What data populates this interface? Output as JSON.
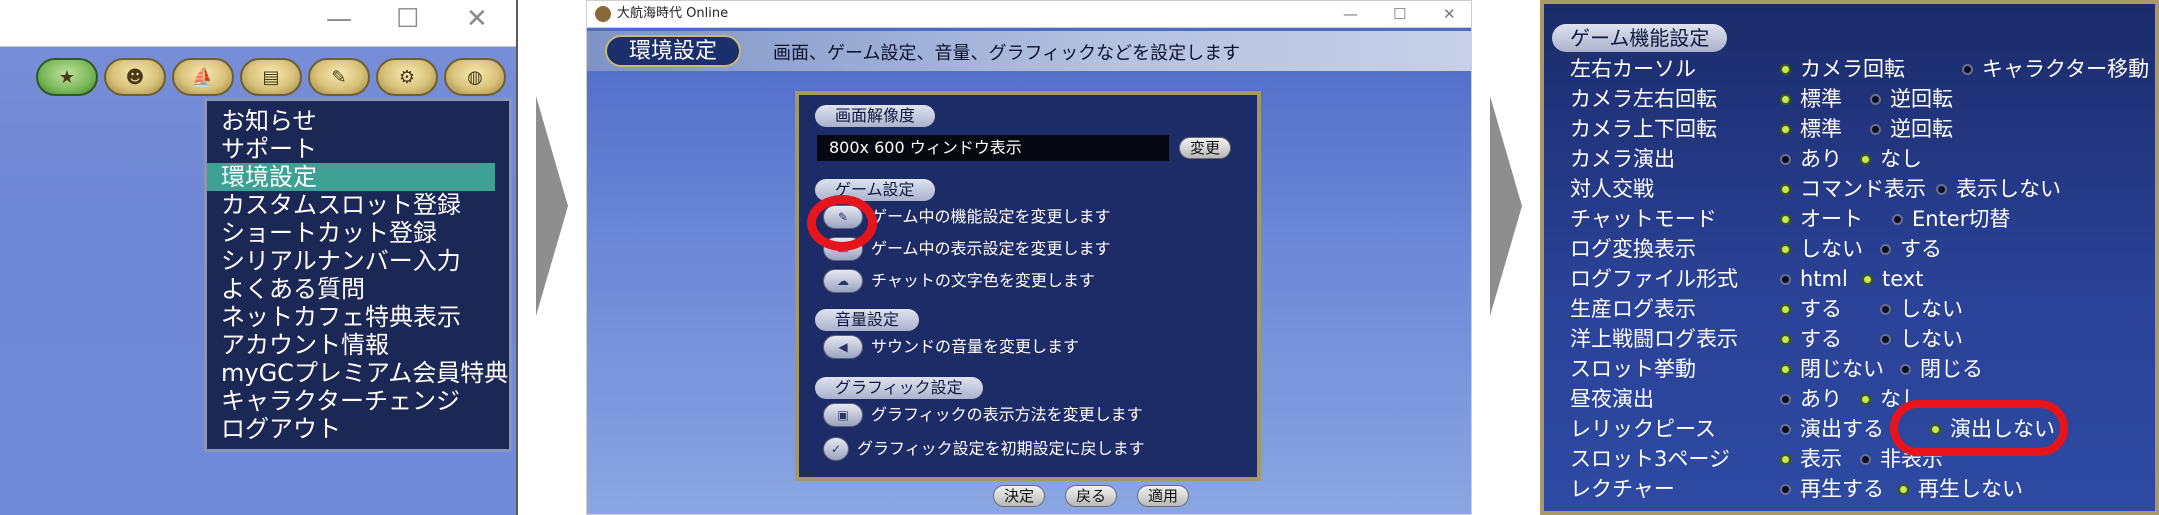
{
  "panel1": {
    "window_controls": [
      "—",
      "☐",
      "✕"
    ],
    "icons": [
      "star-coin-icon",
      "pirate-icon",
      "ship-icon",
      "book-icon",
      "scroll-icon",
      "cart-icon",
      "globe-icon"
    ],
    "menu_items": [
      "お知らせ",
      "サポート",
      "環境設定",
      "カスタムスロット登録",
      "ショートカット登録",
      "シリアルナンバー入力",
      "よくある質問",
      "ネットカフェ特典表示",
      "アカウント情報",
      "myGCプレミアム会員特典",
      "キャラクターチェンジ",
      "ログアウト"
    ],
    "selected_index": 2
  },
  "panel2": {
    "app_title": "大航海時代 Online",
    "window_controls": [
      "—",
      "☐",
      "✕"
    ],
    "header_tag": "環境設定",
    "header_desc": "画面、ゲーム設定、音量、グラフィックなどを設定します",
    "sections": {
      "resolution": {
        "title": "画面解像度",
        "value": "800x 600 ウィンドウ表示",
        "change_button": "変更"
      },
      "game": {
        "title": "ゲーム設定",
        "rows": [
          "ゲーム中の機能設定を変更します",
          "ゲーム中の表示設定を変更します",
          "チャットの文字色を変更します"
        ]
      },
      "volume": {
        "title": "音量設定",
        "rows": [
          "サウンドの音量を変更します"
        ]
      },
      "graphics": {
        "title": "グラフィック設定",
        "rows": [
          "グラフィックの表示方法を変更します",
          "グラフィック設定を初期設定に戻します"
        ]
      }
    },
    "bottom_buttons": [
      "決定",
      "戻る",
      "適用"
    ]
  },
  "panel3": {
    "title": "ゲーム機能設定",
    "rows": [
      {
        "label": "左右カーソル",
        "options": [
          {
            "text": "カメラ回転",
            "on": true
          },
          {
            "text": "キャラクター移動",
            "on": false
          }
        ]
      },
      {
        "label": "カメラ左右回転",
        "options": [
          {
            "text": "標準",
            "on": true
          },
          {
            "text": "逆回転",
            "on": false
          }
        ]
      },
      {
        "label": "カメラ上下回転",
        "options": [
          {
            "text": "標準",
            "on": true
          },
          {
            "text": "逆回転",
            "on": false
          }
        ]
      },
      {
        "label": "カメラ演出",
        "options": [
          {
            "text": "あり",
            "on": false
          },
          {
            "text": "なし",
            "on": true
          }
        ]
      },
      {
        "label": "対人交戦",
        "options": [
          {
            "text": "コマンド表示",
            "on": true
          },
          {
            "text": "表示しない",
            "on": false
          }
        ]
      },
      {
        "label": "チャットモード",
        "options": [
          {
            "text": "オート",
            "on": true
          },
          {
            "text": "Enter切替",
            "on": false
          }
        ]
      },
      {
        "label": "ログ変換表示",
        "options": [
          {
            "text": "しない",
            "on": true
          },
          {
            "text": "する",
            "on": false
          }
        ]
      },
      {
        "label": "ログファイル形式",
        "options": [
          {
            "text": "html",
            "on": false
          },
          {
            "text": "text",
            "on": true
          }
        ]
      },
      {
        "label": "生産ログ表示",
        "options": [
          {
            "text": "する",
            "on": true
          },
          {
            "text": "しない",
            "on": false
          }
        ]
      },
      {
        "label": "洋上戦闘ログ表示",
        "options": [
          {
            "text": "する",
            "on": true
          },
          {
            "text": "しない",
            "on": false
          }
        ]
      },
      {
        "label": "スロット挙動",
        "options": [
          {
            "text": "閉じない",
            "on": true
          },
          {
            "text": "閉じる",
            "on": false
          }
        ]
      },
      {
        "label": "昼夜演出",
        "options": [
          {
            "text": "あり",
            "on": false
          },
          {
            "text": "なし",
            "on": true
          }
        ]
      },
      {
        "label": "レリックピース",
        "options": [
          {
            "text": "演出する",
            "on": false
          },
          {
            "text": "演出しない",
            "on": true
          }
        ]
      },
      {
        "label": "スロット3ページ",
        "options": [
          {
            "text": "表示",
            "on": true
          },
          {
            "text": "非表示",
            "on": false
          }
        ]
      },
      {
        "label": "レクチャー",
        "options": [
          {
            "text": "再生する",
            "on": false
          },
          {
            "text": "再生しない",
            "on": true
          }
        ]
      }
    ]
  }
}
